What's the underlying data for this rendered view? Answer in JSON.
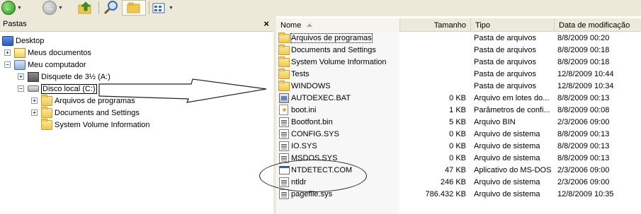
{
  "toolbar": {
    "back_icon": "back-arrow-icon",
    "forward_icon": "forward-arrow-icon",
    "up_icon": "up-folder-icon",
    "search_icon": "search-icon",
    "folders_icon": "folders-icon",
    "views_icon": "views-icon"
  },
  "folders_pane": {
    "title": "Pastas",
    "close": "×",
    "tree": [
      {
        "label": "Desktop",
        "icon": "desktop-icon"
      },
      {
        "label": "Meus documentos",
        "icon": "my-documents-icon",
        "expander": "+"
      },
      {
        "label": "Meu computador",
        "icon": "my-computer-icon",
        "expander": "−"
      },
      {
        "label": "Disquete de 3½ (A:)",
        "icon": "floppy-icon",
        "expander": "+"
      },
      {
        "label": "Disco local (C:)",
        "icon": "hard-drive-icon",
        "expander": "−",
        "selected": true
      },
      {
        "label": "Arquivos de programas",
        "icon": "folder-icon",
        "expander": "+"
      },
      {
        "label": "Documents and Settings",
        "icon": "folder-icon",
        "expander": "+"
      },
      {
        "label": "System Volume Information",
        "icon": "folder-icon"
      }
    ]
  },
  "file_list": {
    "columns": {
      "name": "Nome",
      "size": "Tamanho",
      "type": "Tipo",
      "date": "Data de modificação"
    },
    "sorted_column": "name",
    "rows": [
      {
        "name": "Arquivos de programas",
        "size": "",
        "type": "Pasta de arquivos",
        "date": "8/8/2009 00:20",
        "icon": "folder"
      },
      {
        "name": "Documents and Settings",
        "size": "",
        "type": "Pasta de arquivos",
        "date": "8/8/2009 00:18",
        "icon": "folder"
      },
      {
        "name": "System Volume Information",
        "size": "",
        "type": "Pasta de arquivos",
        "date": "8/8/2009 00:18",
        "icon": "folder"
      },
      {
        "name": "Tests",
        "size": "",
        "type": "Pasta de arquivos",
        "date": "12/8/2009 10:44",
        "icon": "folder"
      },
      {
        "name": "WINDOWS",
        "size": "",
        "type": "Pasta de arquivos",
        "date": "12/8/2009 10:34",
        "icon": "folder"
      },
      {
        "name": "AUTOEXEC.BAT",
        "size": "0 KB",
        "type": "Arquivo em lotes do...",
        "date": "8/8/2009 00:13",
        "icon": "bat"
      },
      {
        "name": "boot.ini",
        "size": "1 KB",
        "type": "Parâmetros de confi...",
        "date": "8/8/2009 00:08",
        "icon": "ini"
      },
      {
        "name": "Bootfont.bin",
        "size": "5 KB",
        "type": "Arquivo BIN",
        "date": "2/3/2006 09:00",
        "icon": "sys"
      },
      {
        "name": "CONFIG.SYS",
        "size": "0 KB",
        "type": "Arquivo de sistema",
        "date": "8/8/2009 00:13",
        "icon": "sys"
      },
      {
        "name": "IO.SYS",
        "size": "0 KB",
        "type": "Arquivo de sistema",
        "date": "8/8/2009 00:13",
        "icon": "sys"
      },
      {
        "name": "MSDOS.SYS",
        "size": "0 KB",
        "type": "Arquivo de sistema",
        "date": "8/8/2009 00:13",
        "icon": "sys"
      },
      {
        "name": "NTDETECT.COM",
        "size": "47 KB",
        "type": "Aplicativo do MS-DOS",
        "date": "2/3/2006 09:00",
        "icon": "app"
      },
      {
        "name": "ntldr",
        "size": "246 KB",
        "type": "Arquivo de sistema",
        "date": "2/3/2006 09:00",
        "icon": "sys"
      },
      {
        "name": "pagefile.sys",
        "size": "786.432 KB",
        "type": "Arquivo de sistema",
        "date": "12/8/2009 10:35",
        "icon": "sys"
      }
    ]
  },
  "colors": {
    "chrome": "#ece9d8",
    "header": "#ebeadb",
    "folder": "#f0c84b",
    "annotation": "#222222"
  }
}
